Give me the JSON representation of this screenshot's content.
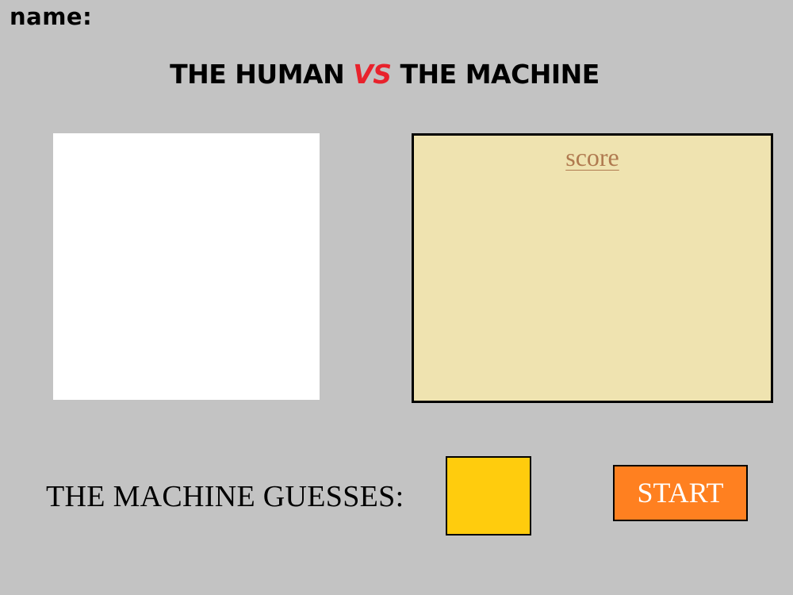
{
  "header": {
    "name_label": "name:"
  },
  "title": {
    "part1": "THE HUMAN",
    "vs": "VS",
    "part2": "THE MACHINE"
  },
  "score_panel": {
    "heading": "score"
  },
  "guess": {
    "label": "THE MACHINE GUESSES:"
  },
  "start_button": {
    "label": "START"
  },
  "colors": {
    "page_background": "#c3c3c3",
    "vs_color": "#e8222c",
    "canvas_background": "#ffffff",
    "score_background": "#efe3b0",
    "score_heading_color": "#b07a50",
    "guess_color": "#ffcc0d",
    "start_button_color": "#ff8020"
  }
}
